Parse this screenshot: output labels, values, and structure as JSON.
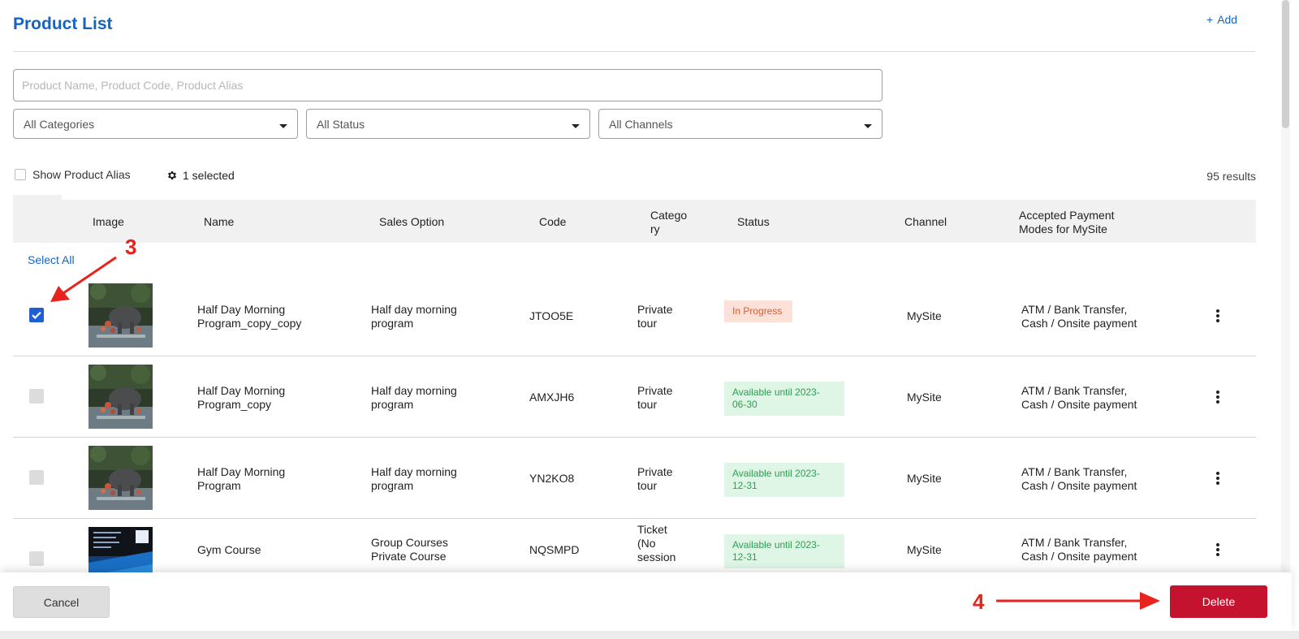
{
  "header": {
    "title": "Product List",
    "add_label": "Add"
  },
  "search": {
    "placeholder": "Product Name, Product Code, Product Alias",
    "value": ""
  },
  "filters": {
    "category": "All Categories",
    "status": "All Status",
    "channel": "All Channels"
  },
  "toolbar": {
    "show_alias_label": "Show Product Alias",
    "selected_label": "1 selected",
    "results_label": "95 results"
  },
  "table": {
    "columns": {
      "image": "Image",
      "name": "Name",
      "sales_option": "Sales Option",
      "code": "Code",
      "category": "Catego\nry",
      "status": "Status",
      "channel": "Channel",
      "payment": "Accepted Payment\nModes for MySite"
    },
    "select_all_label": "Select All",
    "rows": [
      {
        "checked": true,
        "name": "Half Day Morning\nProgram_copy_copy",
        "sales_option": "Half day morning\nprogram",
        "code": "JTOO5E",
        "category": "Private\ntour",
        "status": "In Progress",
        "status_type": "progress",
        "channel": "MySite",
        "payment": "ATM / Bank Transfer,\nCash / Onsite payment"
      },
      {
        "checked": false,
        "name": "Half Day Morning\nProgram_copy",
        "sales_option": "Half day morning\nprogram",
        "code": "AMXJH6",
        "category": "Private\ntour",
        "status": "Available until 2023-\n06-30",
        "status_type": "available",
        "channel": "MySite",
        "payment": "ATM / Bank Transfer,\nCash / Onsite payment"
      },
      {
        "checked": false,
        "name": "Half Day Morning\nProgram",
        "sales_option": "Half day morning\nprogram",
        "code": "YN2KO8",
        "category": "Private\ntour",
        "status": "Available until 2023-\n12-31",
        "status_type": "available",
        "channel": "MySite",
        "payment": "ATM / Bank Transfer,\nCash / Onsite payment"
      },
      {
        "checked": false,
        "name": "Gym Course",
        "sales_option": "Group Courses\nPrivate Course",
        "code": "NQSMPD",
        "category": "Ticket\n(No\nsession",
        "status": "Available until 2023-\n12-31",
        "status_type": "available",
        "channel": "MySite",
        "payment": "ATM / Bank Transfer,\nCash / Onsite payment"
      }
    ]
  },
  "footer": {
    "cancel_label": "Cancel",
    "delete_label": "Delete"
  },
  "annotations": {
    "step_3": "3",
    "step_4": "4",
    "color": "#e8231d"
  },
  "colors": {
    "accent": "#1565c0",
    "checkbox_checked": "#1f5fd1",
    "delete": "#c4122f",
    "in_progress_bg": "#fbe1d8",
    "in_progress_text": "#d75b34",
    "available_bg": "#dff6e7",
    "available_text": "#2e9d52"
  }
}
